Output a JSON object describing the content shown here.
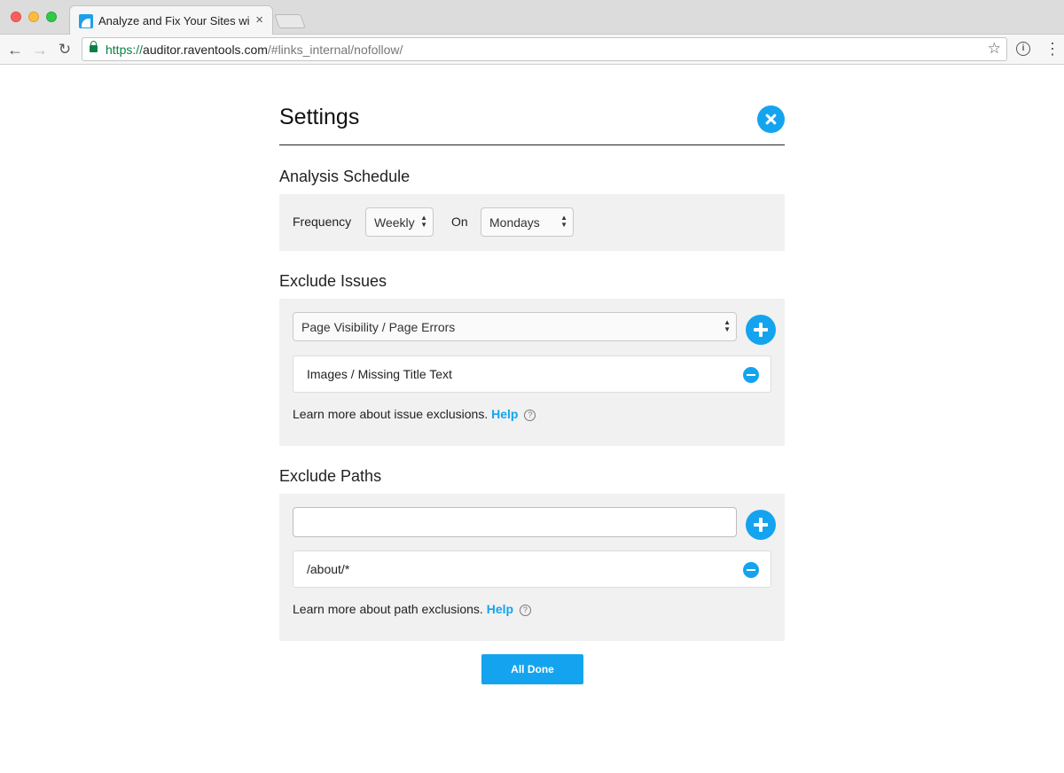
{
  "browser": {
    "tab_title": "Analyze and Fix Your Sites with Raven",
    "tab_close": "×",
    "url_scheme": "https://",
    "url_host": "auditor.raventools.com",
    "url_path": "/#links_internal/nofollow/",
    "back_icon": "←",
    "forward_icon": "→",
    "reload_icon": "↻",
    "star_icon": "☆",
    "info_icon": "i",
    "menu_icon": "⋮"
  },
  "settings": {
    "title": "Settings",
    "schedule": {
      "heading": "Analysis Schedule",
      "frequency_label": "Frequency",
      "frequency_value": "Weekly",
      "on_label": "On",
      "day_value": "Mondays"
    },
    "exclude_issues": {
      "heading": "Exclude Issues",
      "select_value": "Page Visibility / Page Errors",
      "items": [
        "Images / Missing Title Text"
      ],
      "help_text": "Learn more about issue exclusions.",
      "help_link": "Help"
    },
    "exclude_paths": {
      "heading": "Exclude Paths",
      "input_value": "",
      "items": [
        "/about/*"
      ],
      "help_text": "Learn more about path exclusions.",
      "help_link": "Help"
    },
    "done_label": "All Done"
  },
  "colors": {
    "accent": "#14a4ef",
    "panel_bg": "#f1f1f1"
  }
}
